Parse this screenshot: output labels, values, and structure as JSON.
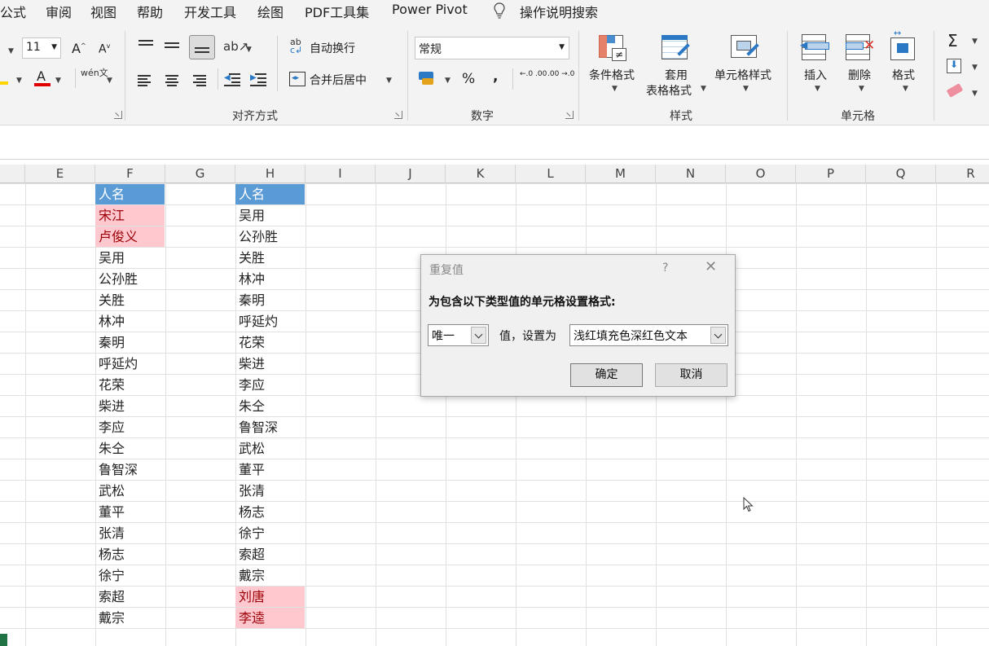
{
  "menu": [
    "公式",
    "审阅",
    "视图",
    "帮助",
    "开发工具",
    "绘图",
    "PDF工具集",
    "Power Pivot",
    "操作说明搜索"
  ],
  "font": {
    "size": "11",
    "grow_label": "A",
    "shrink_label": "A",
    "font_color_label": "A",
    "phonetic_label": "wén文"
  },
  "alignment": {
    "wrap_text": "自动换行",
    "merge_center": "合并后居中",
    "group_label": "对齐方式"
  },
  "number": {
    "format": "常规",
    "percent": "%",
    "comma": ",",
    "inc_decimal": "←.0 .00",
    "dec_decimal": ".00 →.0",
    "group_label": "数字"
  },
  "styles": {
    "conditional": "条件格式",
    "table_line1": "套用",
    "table_line2": "表格格式",
    "cell_styles": "单元格样式",
    "group_label": "样式"
  },
  "cells": {
    "insert": "插入",
    "delete": "删除",
    "format": "格式",
    "group_label": "单元格"
  },
  "editing": {
    "sum": "Σ"
  },
  "columns": [
    "E",
    "F",
    "G",
    "H",
    "I",
    "J",
    "K",
    "L",
    "M",
    "N",
    "O",
    "P",
    "Q",
    "R"
  ],
  "sheet": {
    "f_header": "人名",
    "f_values": [
      "宋江",
      "卢俊义",
      "吴用",
      "公孙胜",
      "关胜",
      "林冲",
      "秦明",
      "呼延灼",
      "花荣",
      "柴进",
      "李应",
      "朱仝",
      "鲁智深",
      "武松",
      "董平",
      "张清",
      "杨志",
      "徐宁",
      "索超",
      "戴宗"
    ],
    "f_duplicate_flags": [
      true,
      true,
      false,
      false,
      false,
      false,
      false,
      false,
      false,
      false,
      false,
      false,
      false,
      false,
      false,
      false,
      false,
      false,
      false,
      false
    ],
    "h_header": "人名",
    "h_values": [
      "吴用",
      "公孙胜",
      "关胜",
      "林冲",
      "秦明",
      "呼延灼",
      "花荣",
      "柴进",
      "李应",
      "朱仝",
      "鲁智深",
      "武松",
      "董平",
      "张清",
      "杨志",
      "徐宁",
      "索超",
      "戴宗",
      "刘唐",
      "李逵"
    ],
    "h_duplicate_flags": [
      false,
      false,
      false,
      false,
      false,
      false,
      false,
      false,
      false,
      false,
      false,
      false,
      false,
      false,
      false,
      false,
      false,
      false,
      true,
      true
    ]
  },
  "dialog": {
    "title": "重复值",
    "help": "?",
    "close": "✕",
    "prompt": "为包含以下类型值的单元格设置格式:",
    "type_value": "唯一",
    "mid_label": "值，设置为",
    "format_value": "浅红填充色深红色文本",
    "ok": "确定",
    "cancel": "取消"
  },
  "colors": {
    "header_fill": "#5b9bd5",
    "dup_fill": "#ffc7ce",
    "dup_text": "#9c0006",
    "excel_green": "#217346"
  }
}
